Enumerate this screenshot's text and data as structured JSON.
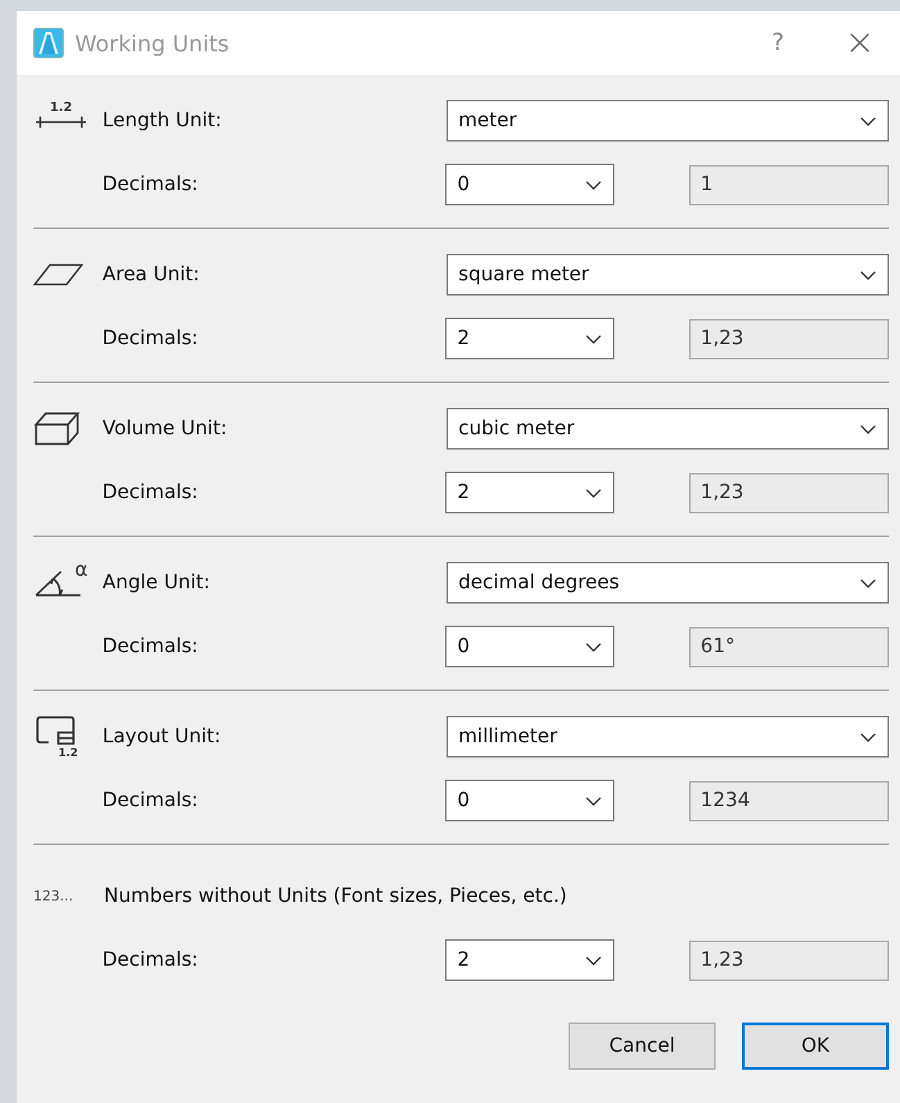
{
  "window": {
    "title": "Working Units",
    "help": "?",
    "close": "×"
  },
  "sections": [
    {
      "kind": "length",
      "icon_text": "1.2",
      "label": "Length Unit:",
      "unit": "meter",
      "decimals_label": "Decimals:",
      "decimals": "0",
      "preview": "1"
    },
    {
      "kind": "area",
      "label": "Area Unit:",
      "unit": "square meter",
      "decimals_label": "Decimals:",
      "decimals": "2",
      "preview": "1,23"
    },
    {
      "kind": "volume",
      "label": "Volume Unit:",
      "unit": "cubic meter",
      "decimals_label": "Decimals:",
      "decimals": "2",
      "preview": "1,23"
    },
    {
      "kind": "angle",
      "icon_text": "α",
      "label": "Angle Unit:",
      "unit": "decimal degrees",
      "decimals_label": "Decimals:",
      "decimals": "0",
      "preview": "61°"
    },
    {
      "kind": "layout",
      "icon_text": "1.2",
      "label": "Layout Unit:",
      "unit": "millimeter",
      "decimals_label": "Decimals:",
      "decimals": "0",
      "preview": "1234"
    },
    {
      "kind": "numbers",
      "icon_text": "123...",
      "label": "Numbers without Units (Font sizes, Pieces, etc.)",
      "decimals_label": "Decimals:",
      "decimals": "2",
      "preview": "1,23"
    }
  ],
  "buttons": [
    {
      "label": "Cancel",
      "default": false
    },
    {
      "label": "OK",
      "default": true
    }
  ]
}
